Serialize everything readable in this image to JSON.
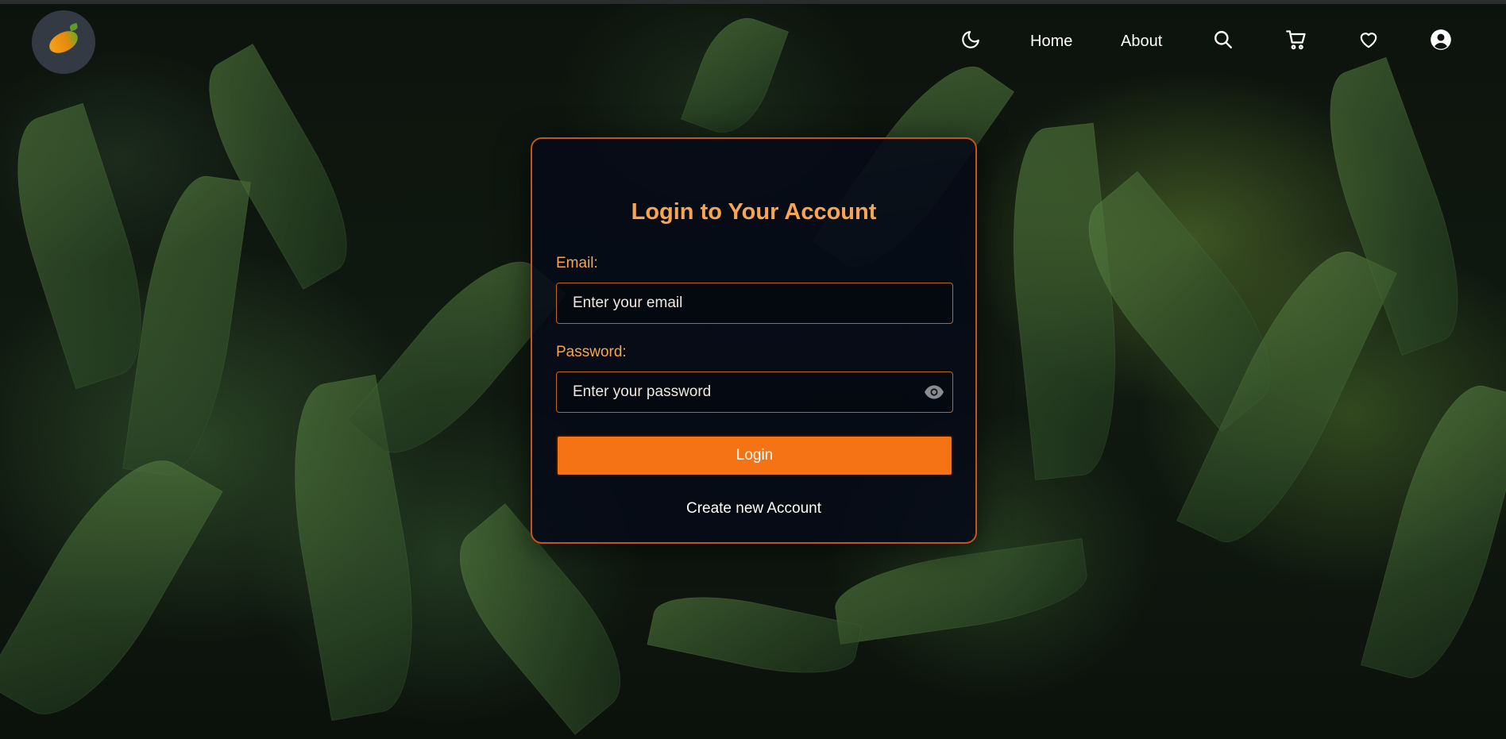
{
  "nav": {
    "logo_name": "brand-logo",
    "home_label": "Home",
    "about_label": "About",
    "icons": [
      "moon-icon",
      "search-icon",
      "cart-icon",
      "heart-icon",
      "user-icon"
    ]
  },
  "login": {
    "title": "Login to Your Account",
    "email_label": "Email:",
    "email_placeholder": "Enter your email",
    "email_value": "",
    "password_label": "Password:",
    "password_placeholder": "Enter your password",
    "password_value": "",
    "login_button": "Login",
    "create_account_link": "Create new Account"
  },
  "colors": {
    "accent": "#f57315",
    "label": "#f7a550",
    "card_border": "#c0561d",
    "card_bg": "#060a18"
  }
}
